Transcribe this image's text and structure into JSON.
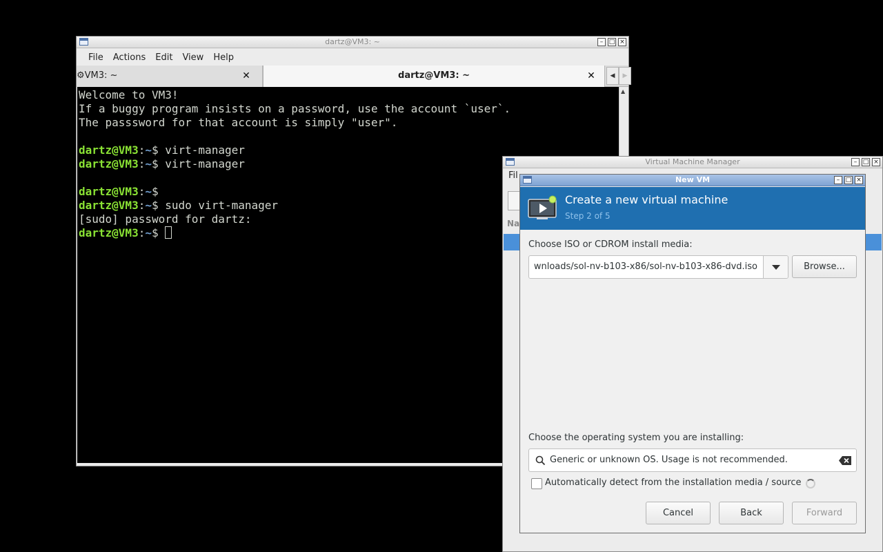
{
  "terminal": {
    "window_title": "dartz@VM3: ~",
    "menu": [
      "File",
      "Actions",
      "Edit",
      "View",
      "Help"
    ],
    "tabs": [
      {
        "label": "⚙VM3: ~",
        "active": false
      },
      {
        "label": "dartz@VM3: ~",
        "active": true
      }
    ],
    "lines": [
      {
        "type": "text",
        "text": "Welcome to VM3!"
      },
      {
        "type": "text",
        "text": "If a buggy program insists on a password, use the account `user`."
      },
      {
        "type": "text",
        "text": "The passsword for that account is simply \"user\"."
      },
      {
        "type": "text",
        "text": ""
      },
      {
        "type": "prompt",
        "user": "dartz@VM3",
        "path": "~",
        "cmd": " virt-manager"
      },
      {
        "type": "prompt",
        "user": "dartz@VM3",
        "path": "~",
        "cmd": " virt-manager"
      },
      {
        "type": "text",
        "text": ""
      },
      {
        "type": "prompt",
        "user": "dartz@VM3",
        "path": "~",
        "cmd": ""
      },
      {
        "type": "prompt",
        "user": "dartz@VM3",
        "path": "~",
        "cmd": " sudo virt-manager"
      },
      {
        "type": "text",
        "text": "[sudo] password for dartz:"
      },
      {
        "type": "prompt",
        "user": "dartz@VM3",
        "path": "~",
        "cmd": " ",
        "cursor": true
      }
    ]
  },
  "vmm": {
    "window_title": "Virtual Machine Manager",
    "menu_partial": "Fil",
    "column_partial": "Na"
  },
  "newvm": {
    "window_title": "New VM",
    "header_title": "Create a new virtual machine",
    "header_step": "Step 2 of 5",
    "iso_label": "Choose ISO or CDROM install media:",
    "iso_value": "wnloads/sol-nv-b103-x86/sol-nv-b103-x86-dvd.iso",
    "browse_label": "Browse...",
    "os_label": "Choose the operating system you are installing:",
    "os_value": "Generic or unknown OS. Usage is not recommended.",
    "autodetect_label": "Automatically detect from the installation media / source",
    "autodetect_checked": false,
    "buttons": {
      "cancel": "Cancel",
      "back": "Back",
      "forward": "Forward"
    }
  },
  "colors": {
    "accent": "#1f6fb0",
    "prompt_user": "#8ae234",
    "prompt_path": "#729fcf"
  }
}
